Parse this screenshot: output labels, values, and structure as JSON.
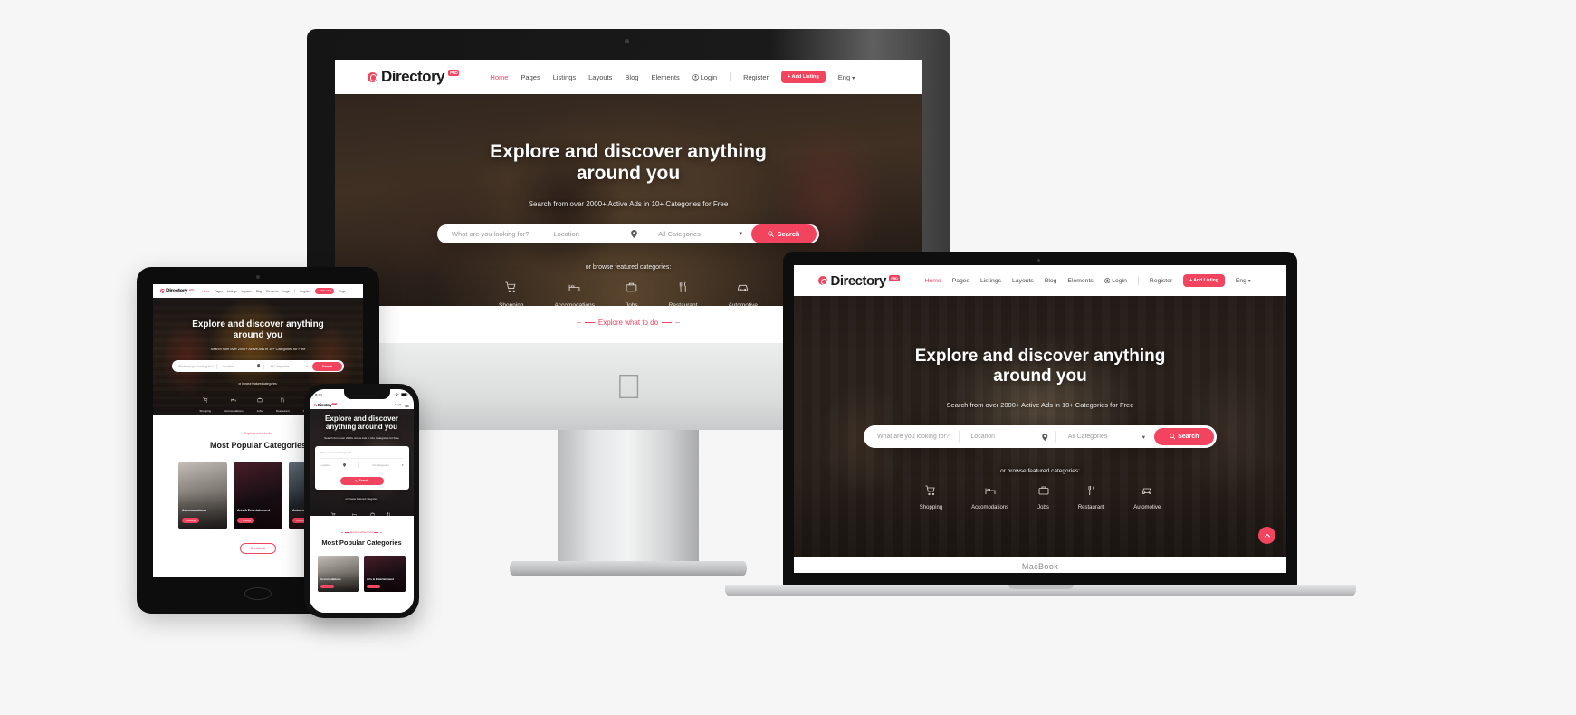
{
  "site": {
    "brand": {
      "name": "Directory",
      "badge": "PRO"
    },
    "nav": {
      "items": [
        "Home",
        "Pages",
        "Listings",
        "Layouts",
        "Blog",
        "Elements"
      ],
      "login": "Login",
      "register": "Register",
      "add_listing": "+ Add Listing",
      "language": "Eng",
      "active": "Home"
    },
    "hero": {
      "title_line1": "Explore and discover anything",
      "title_line2": "around you",
      "subtitle": "Search from over 2000+ Active Ads in 10+ Categories for Free",
      "search": {
        "keyword_placeholder": "What are you looking for?",
        "location_placeholder": "Location",
        "category_value": "All Categories",
        "button_label": "Search"
      },
      "browse_label": "or browse featured categories:",
      "categories": [
        {
          "label": "Shopping",
          "icon": "shopping-cart-icon"
        },
        {
          "label": "Accomodations",
          "icon": "bed-icon"
        },
        {
          "label": "Jobs",
          "icon": "briefcase-icon"
        },
        {
          "label": "Restaurant",
          "icon": "cutlery-icon"
        },
        {
          "label": "Automotive",
          "icon": "car-icon"
        }
      ]
    },
    "popular": {
      "eyebrow": "Explore what to do",
      "title": "Most Popular Categories",
      "cards": [
        {
          "name": "Accomodations",
          "badge": "8 Listings"
        },
        {
          "name": "Arts & Entertainment",
          "badge": "7 Listings"
        },
        {
          "name": "Automotive",
          "badge": "6 Listings"
        }
      ],
      "browse_all": "Browse All"
    }
  },
  "phone": {
    "status_time": "9:41",
    "status_right": "Wi-Fi  Battery"
  },
  "macbook": {
    "label": "MacBook"
  },
  "colors": {
    "accent": "#f2435f",
    "text_dark": "#1c1c1c",
    "muted": "#9a9a9a",
    "page_bg": "#f6f6f6"
  }
}
